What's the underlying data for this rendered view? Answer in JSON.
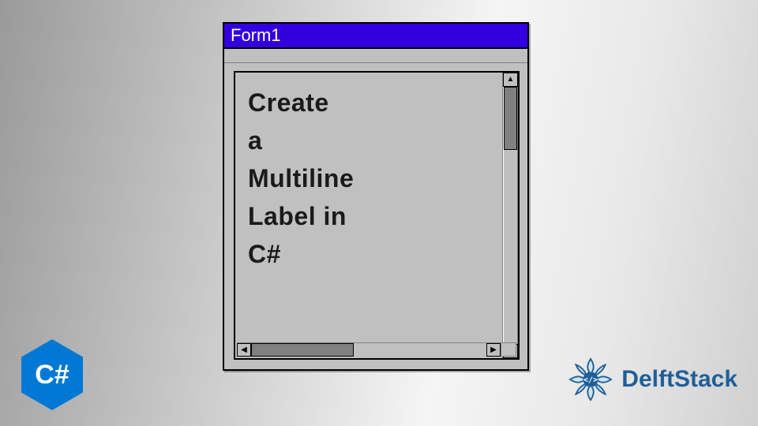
{
  "window": {
    "title": "Form1"
  },
  "label": {
    "lines": [
      "Create",
      "a",
      "Multiline",
      "Label in",
      "C#"
    ]
  },
  "badges": {
    "csharp": "C#",
    "delftstack": "DelftStack"
  },
  "colors": {
    "titlebar": "#3200de",
    "csharp_badge": "#0078d4",
    "delft_brand": "#1f5f99",
    "window_face": "#c0c0c0"
  }
}
